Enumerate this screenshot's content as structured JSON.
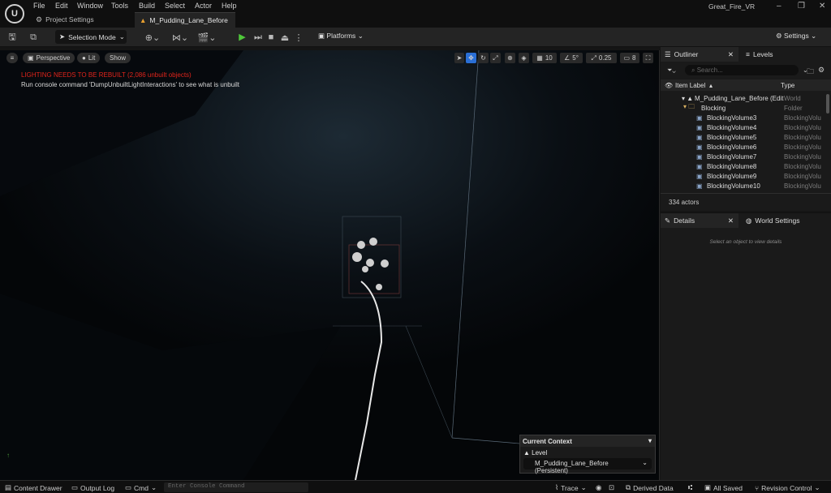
{
  "titlebar": {
    "menus": [
      "File",
      "Edit",
      "Window",
      "Tools",
      "Build",
      "Select",
      "Actor",
      "Help"
    ],
    "project_tab": "Project Settings",
    "level_tab": "M_Pudding_Lane_Before",
    "app_title": "Great_Fire_VR"
  },
  "toolbar": {
    "selection_mode": "Selection Mode",
    "platforms": "Platforms",
    "settings": "Settings"
  },
  "viewport": {
    "perspective": "Perspective",
    "lit": "Lit",
    "show": "Show",
    "warning": "LIGHTING NEEDS TO BE REBUILT (2,086 unbuilt objects)",
    "hint": "Run console command 'DumpUnbuiltLightInteractions' to see what is unbuilt",
    "grid_snap": "10",
    "rot_snap": "5°",
    "scale_snap": "0.25",
    "cam_speed": "8"
  },
  "context": {
    "header": "Current Context",
    "level_label": "Level",
    "level_value": "M_Pudding_Lane_Before (Persistent)"
  },
  "outliner": {
    "tab": "Outliner",
    "levels_tab": "Levels",
    "search_placeholder": "Search...",
    "col_label": "Item Label",
    "col_type": "Type",
    "rows": [
      {
        "label": "M_Pudding_Lane_Before (Edit",
        "type": "World"
      },
      {
        "label": "Blocking",
        "type": "Folder"
      },
      {
        "label": "BlockingVolume3",
        "type": "BlockingVolu"
      },
      {
        "label": "BlockingVolume4",
        "type": "BlockingVolu"
      },
      {
        "label": "BlockingVolume5",
        "type": "BlockingVolu"
      },
      {
        "label": "BlockingVolume6",
        "type": "BlockingVolu"
      },
      {
        "label": "BlockingVolume7",
        "type": "BlockingVolu"
      },
      {
        "label": "BlockingVolume8",
        "type": "BlockingVolu"
      },
      {
        "label": "BlockingVolume9",
        "type": "BlockingVolu"
      },
      {
        "label": "BlockingVolume10",
        "type": "BlockingVolu"
      }
    ],
    "actor_count": "334 actors"
  },
  "details": {
    "tab": "Details",
    "world_tab": "World Settings",
    "empty": "Select an object to view details"
  },
  "statusbar": {
    "content_drawer": "Content Drawer",
    "output_log": "Output Log",
    "cmd": "Cmd",
    "console_placeholder": "Enter Console Command",
    "trace": "Trace",
    "derived_data": "Derived Data",
    "all_saved": "All Saved",
    "revision_control": "Revision Control"
  }
}
